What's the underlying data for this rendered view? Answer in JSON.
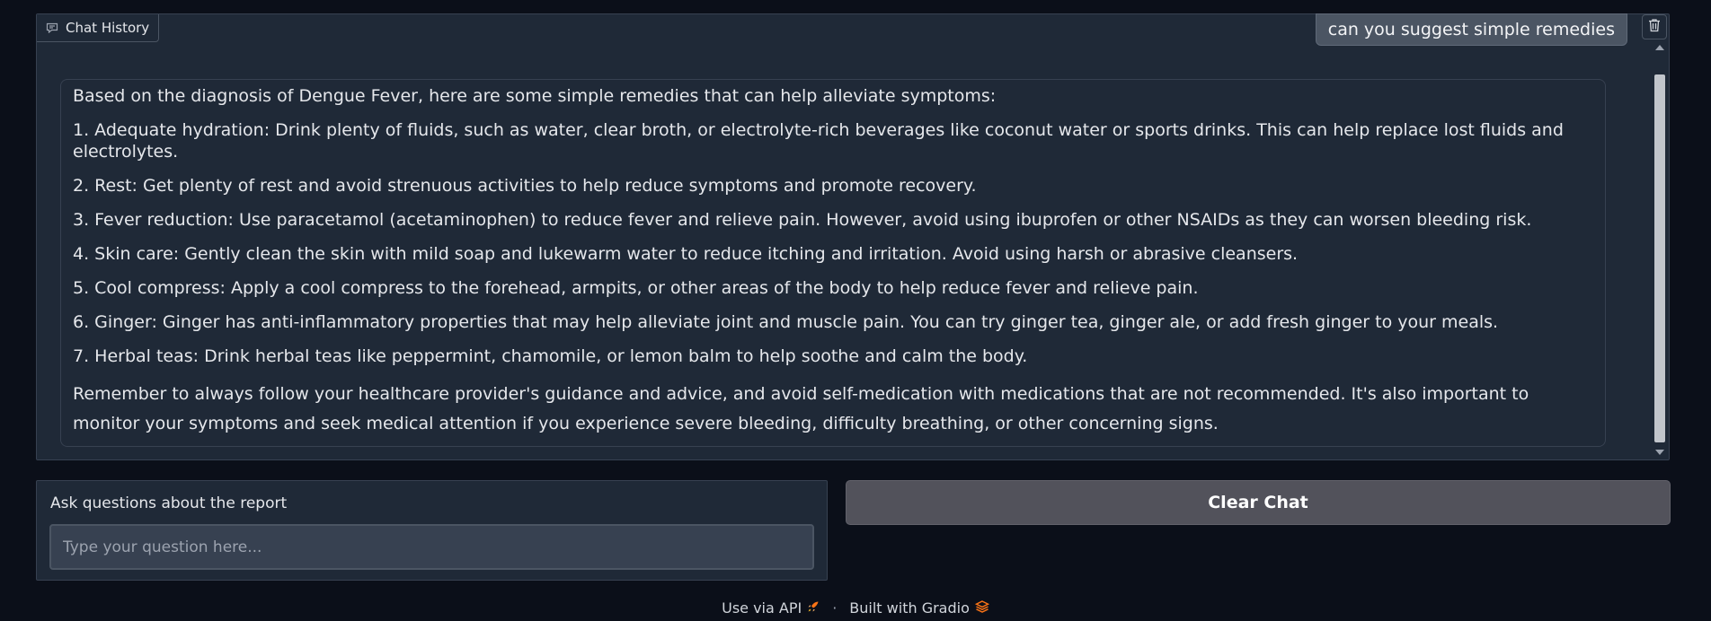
{
  "chatbot": {
    "label": "Chat History",
    "user_message": "can you suggest simple remedies",
    "bot_message": {
      "intro": "Based on the diagnosis of Dengue Fever, here are some simple remedies that can help alleviate symptoms:",
      "items": [
        "1. Adequate hydration: Drink plenty of fluids, such as water, clear broth, or electrolyte-rich beverages like coconut water or sports drinks. This can help replace lost fluids and electrolytes.",
        "2. Rest: Get plenty of rest and avoid strenuous activities to help reduce symptoms and promote recovery.",
        "3. Fever reduction: Use paracetamol (acetaminophen) to reduce fever and relieve pain. However, avoid using ibuprofen or other NSAIDs as they can worsen bleeding risk.",
        "4. Skin care: Gently clean the skin with mild soap and lukewarm water to reduce itching and irritation. Avoid using harsh or abrasive cleansers.",
        "5. Cool compress: Apply a cool compress to the forehead, armpits, or other areas of the body to help reduce fever and relieve pain.",
        "6. Ginger: Ginger has anti-inflammatory properties that may help alleviate joint and muscle pain. You can try ginger tea, ginger ale, or add fresh ginger to your meals.",
        "7. Herbal teas: Drink herbal teas like peppermint, chamomile, or lemon balm to help soothe and calm the body."
      ],
      "closing": "Remember to always follow your healthcare provider's guidance and advice, and avoid self-medication with medications that are not recommended. It's also important to monitor your symptoms and seek medical attention if you experience severe bleeding, difficulty breathing, or other concerning signs."
    },
    "icons": [
      "chat-icon",
      "trash-icon"
    ]
  },
  "question": {
    "label": "Ask questions about the report",
    "placeholder": "Type your question here...",
    "value": ""
  },
  "clear_button": {
    "label": "Clear Chat"
  },
  "footer": {
    "api_label": "Use via API",
    "separator": "·",
    "built_label": "Built with Gradio",
    "icons": [
      "rocket-icon",
      "gradio-logo-icon"
    ]
  },
  "colors": {
    "background": "#0b0f19",
    "panel": "#1f2937",
    "border": "#374151",
    "button": "#52525b",
    "accent": "#f97316"
  }
}
